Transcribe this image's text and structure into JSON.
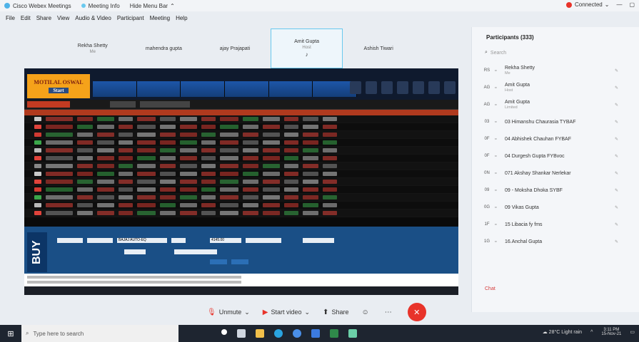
{
  "window": {
    "app_title": "Cisco Webex Meetings",
    "meeting_info": "Meeting Info",
    "hide_menu_bar": "Hide Menu Bar",
    "connection_status": "Connected",
    "status_color": "#e8332a"
  },
  "menu": [
    "File",
    "Edit",
    "Share",
    "View",
    "Audio & Video",
    "Participant",
    "Meeting",
    "Help"
  ],
  "video_strip": [
    {
      "name": "Rekha Shetty",
      "sub": "Me",
      "active": false
    },
    {
      "name": "mahendra gupta",
      "sub": "",
      "active": false
    },
    {
      "name": "ajay Prajapati",
      "sub": "",
      "active": false
    },
    {
      "name": "Amit Gupta",
      "sub": "Host",
      "active": true
    },
    {
      "name": "Ashish Tiwari",
      "sub": "",
      "active": false
    }
  ],
  "shared_app": {
    "logo_text": "MOTILAL OSWAL",
    "start_label": "Start",
    "order_side": "BUY",
    "scrip_value": "BAJAJ AUTO-EQ",
    "price_value": "4145.00"
  },
  "controls": {
    "unmute": "Unmute",
    "start_video": "Start video",
    "share": "Share"
  },
  "participants": {
    "title": "Participants (333)",
    "search_placeholder": "Search",
    "chat_label": "Chat",
    "items": [
      {
        "initials": "RS",
        "name": "Rekha Shetty",
        "sub": "Me"
      },
      {
        "initials": "AG",
        "name": "Amit Gupta",
        "sub": "Host"
      },
      {
        "initials": "AG",
        "name": "Amit Gupta",
        "sub": "Limited"
      },
      {
        "initials": "03",
        "name": "03 Himanshu Chaurasia TYBAF",
        "sub": ""
      },
      {
        "initials": "0F",
        "name": "04 Abhishek Chauhan FYBAF",
        "sub": ""
      },
      {
        "initials": "0F",
        "name": "04 Durgesh Gupta FYBvoc",
        "sub": ""
      },
      {
        "initials": "0N",
        "name": "071 Akshay Shankar Nerlekar",
        "sub": ""
      },
      {
        "initials": "09",
        "name": "09 - Moksha Dhoka SYBF",
        "sub": ""
      },
      {
        "initials": "0G",
        "name": "09 Vikas Gupta",
        "sub": ""
      },
      {
        "initials": "1F",
        "name": "15 Libacia fy fms",
        "sub": ""
      },
      {
        "initials": "1G",
        "name": "16.Anchal Gupta",
        "sub": ""
      }
    ]
  },
  "taskbar": {
    "search_placeholder": "Type here to search",
    "weather": "28°C Light rain",
    "time": "3:11 PM",
    "date": "15-Nov-21"
  }
}
